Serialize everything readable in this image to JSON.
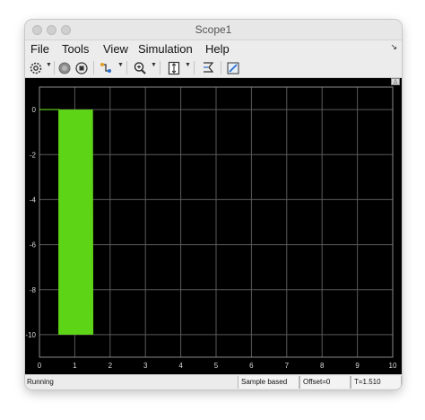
{
  "window": {
    "title": "Scope1"
  },
  "menu": [
    "File",
    "Tools",
    "View",
    "Simulation",
    "Help"
  ],
  "toolbar": {
    "icons": [
      "settings-icon",
      "run-icon",
      "stop-icon",
      "signal-select-icon",
      "zoom-icon",
      "scale-axes-icon",
      "cursor-measure-icon",
      "edit-style-icon"
    ]
  },
  "status": {
    "state": "Running",
    "mode": "Sample based",
    "offset": "Offset=0",
    "time": "T=1.510"
  },
  "colors": {
    "plot_background": "#000000",
    "grid": "#5a5a5a",
    "signal": "#5ed417",
    "tick_text": "#d9d9d9"
  },
  "chart_data": {
    "type": "line",
    "title": "",
    "xlabel": "",
    "ylabel": "",
    "xlim": [
      0,
      10
    ],
    "ylim": [
      -11,
      1
    ],
    "grid": true,
    "x_ticks": [
      "0",
      "1",
      "2",
      "3",
      "4",
      "5",
      "6",
      "7",
      "8",
      "9",
      "10"
    ],
    "y_ticks": [
      "0",
      "-2",
      "-4",
      "-6",
      "-8",
      "-10"
    ],
    "series": [
      {
        "color": "#5ed417",
        "points": [
          [
            0,
            0
          ],
          [
            0.55,
            0
          ],
          [
            0.55,
            -10
          ],
          [
            0.6,
            0
          ],
          [
            0.65,
            -10
          ],
          [
            0.7,
            0
          ],
          [
            0.75,
            -10
          ],
          [
            0.8,
            0
          ],
          [
            0.85,
            -10
          ],
          [
            0.9,
            0
          ],
          [
            0.95,
            -10
          ],
          [
            1.0,
            0
          ],
          [
            1.05,
            -10
          ],
          [
            1.1,
            0
          ],
          [
            1.15,
            -10
          ],
          [
            1.2,
            0
          ],
          [
            1.25,
            -10
          ],
          [
            1.3,
            0
          ],
          [
            1.35,
            -10
          ],
          [
            1.4,
            0
          ],
          [
            1.45,
            -10
          ],
          [
            1.5,
            0
          ],
          [
            1.51,
            -10
          ]
        ],
        "filled_band": {
          "x_start": 0.55,
          "x_end": 1.51,
          "y_low": -10,
          "y_high": 0
        }
      }
    ]
  }
}
